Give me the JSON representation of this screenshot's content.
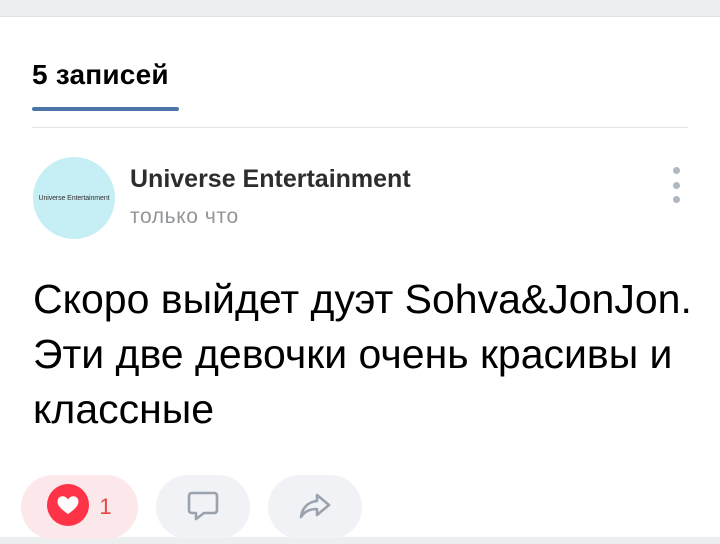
{
  "tabs": {
    "active_label": "5 записей"
  },
  "post": {
    "avatar_text": "Universe Entertainment",
    "author": "Universe Entertainment",
    "time": "только что",
    "text": "Скоро выйдет дуэт Sohva&JonJon. Эти две девочки очень красивы и классные",
    "actions": {
      "likes_count": "1",
      "like_icon": "heart-icon",
      "comment_icon": "comment-icon",
      "share_icon": "share-icon"
    }
  },
  "colors": {
    "accent": "#4a76a8",
    "like": "#ff3347",
    "avatar_bg": "#c6eef5"
  }
}
